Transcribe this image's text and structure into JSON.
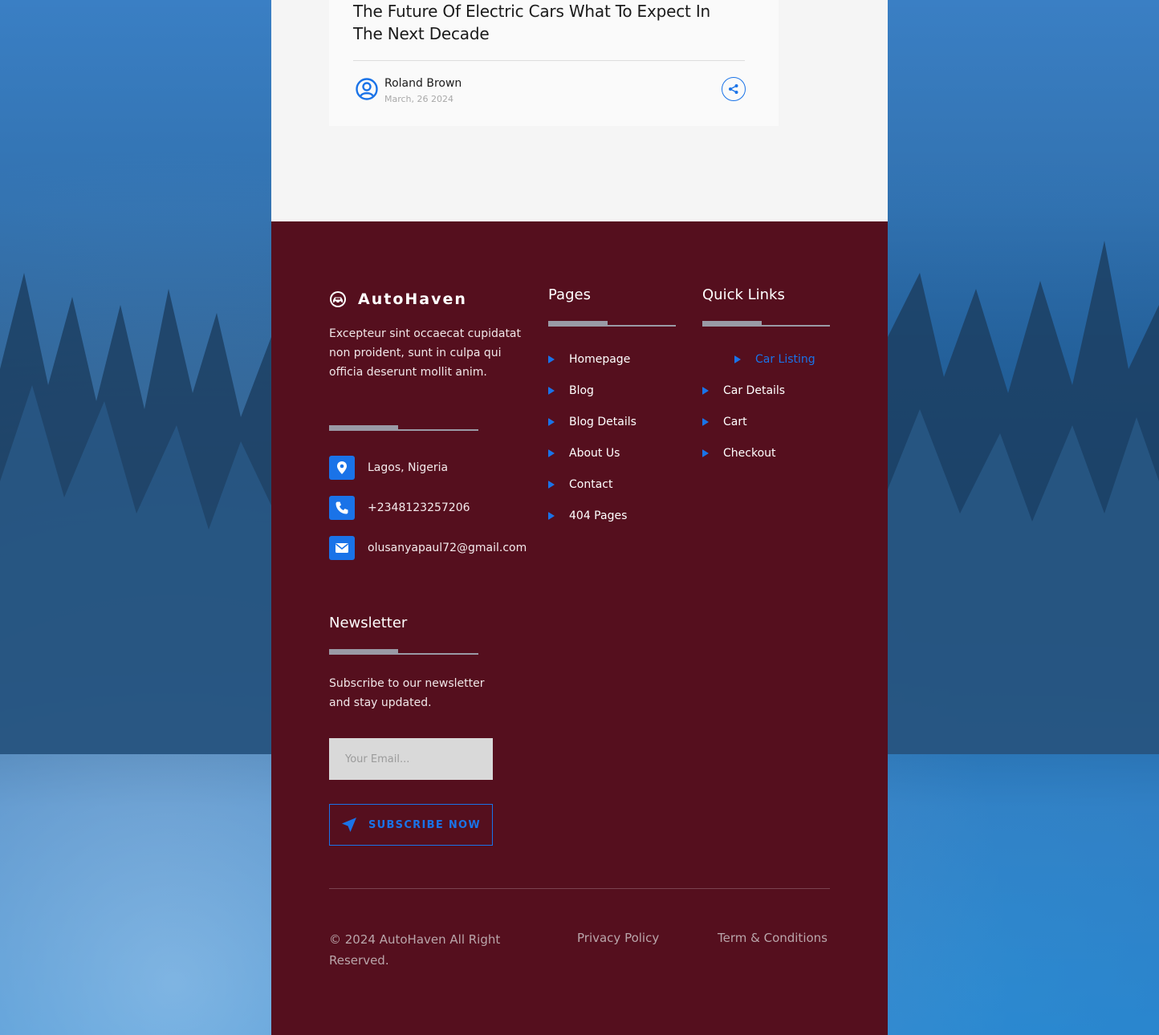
{
  "blog_card": {
    "title": "The Future Of Electric Cars What To Expect In The Next Decade",
    "author_name": "Roland Brown",
    "date": "March, 26 2024",
    "author_icon": "user-circle-icon",
    "share_icon": "share-icon"
  },
  "footer": {
    "brand": {
      "logo_icon": "car-badge-icon",
      "name": "AutoHaven"
    },
    "about": "Excepteur sint occaecat cupidatat non proident, sunt in culpa qui officia deserunt mollit anim.",
    "contacts": [
      {
        "icon": "map-pin-icon",
        "text": "Lagos, Nigeria"
      },
      {
        "icon": "phone-icon",
        "text": "+2348123257206"
      },
      {
        "icon": "mail-icon",
        "text": "olusanyapaul72@gmail.com"
      }
    ],
    "pages": {
      "title": "Pages",
      "items": [
        "Homepage",
        "Blog",
        "Blog Details",
        "About Us",
        "Contact",
        "404 Pages"
      ]
    },
    "quick_links": {
      "title": "Quick Links",
      "items": [
        "Car Listing",
        "Car Details",
        "Cart",
        "Checkout"
      ],
      "active": "Car Listing"
    },
    "newsletter": {
      "title": "Newsletter",
      "text": "Subscribe to our newsletter and stay updated.",
      "placeholder": "Your Email...",
      "button_label": "SUBSCRIBE NOW",
      "button_icon": "send-icon"
    },
    "copyright": "© 2024 AutoHaven All Right Reserved.",
    "privacy": "Privacy Policy",
    "terms": "Term & Conditions"
  },
  "colors": {
    "footer_bg": "#550f1e",
    "accent": "#1a73e8",
    "card_bg": "#fafafa"
  }
}
